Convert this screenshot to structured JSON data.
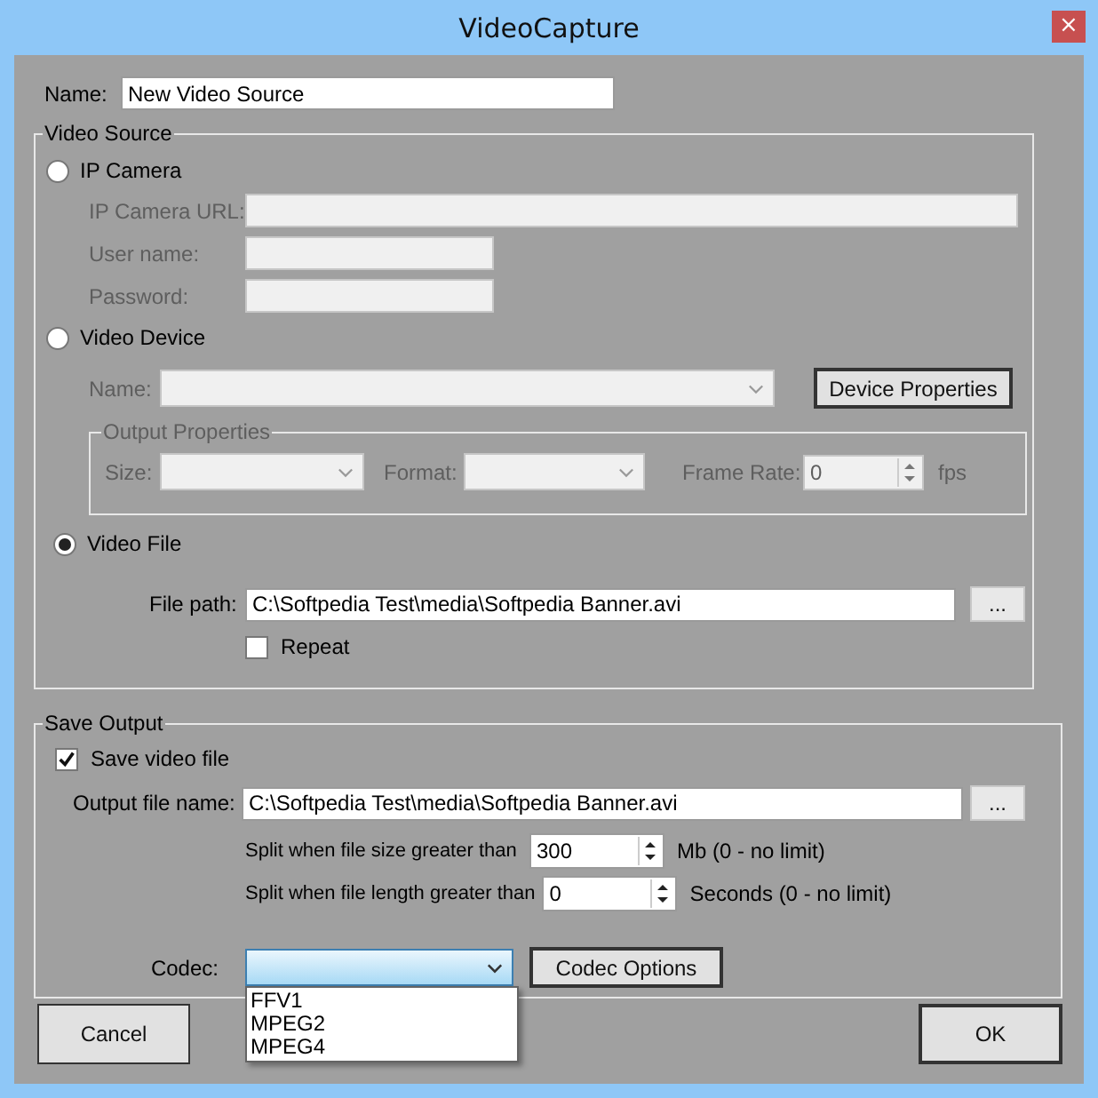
{
  "window": {
    "title": "VideoCapture",
    "close_glyph": "×"
  },
  "name_field": {
    "label": "Name:",
    "value": "New Video Source"
  },
  "video_source": {
    "title": "Video Source",
    "ip_camera": {
      "label": "IP Camera",
      "selected": false,
      "fields": [
        {
          "label": "IP Camera URL:",
          "disabled": true
        },
        {
          "label": "User name:",
          "disabled": true
        },
        {
          "label": "Password:",
          "disabled": true
        }
      ]
    },
    "video_device": {
      "label": "Video Device",
      "selected": false,
      "disabled": true,
      "name_label": "Name:",
      "device_properties_button": "Device Properties",
      "output_properties": {
        "title": "Output Properties",
        "size_label": "Size:",
        "format_label": "Format:",
        "frame_rate_label": "Frame Rate:",
        "frame_rate": "0",
        "fps_label": "fps"
      }
    },
    "video_file": {
      "label": "Video File",
      "selected": true,
      "file_path_label": "File path:",
      "file_path": "C:\\Softpedia Test\\media\\Softpedia Banner.avi",
      "browse_button": "...",
      "repeat": {
        "label": "Repeat",
        "checked": false
      }
    }
  },
  "save_output": {
    "title": "Save Output",
    "save_video_file": {
      "label": "Save video file",
      "checked": true
    },
    "output_file_label": "Output file name:",
    "output_file": "C:\\Softpedia Test\\media\\Softpedia Banner.avi",
    "browse_button": "...",
    "splits": [
      {
        "label": "Split when file size greater than",
        "value": "300",
        "unit": "Mb (0 - no limit)"
      },
      {
        "label": "Split when file length greater than",
        "value": "0",
        "unit": "Seconds (0 - no limit)"
      }
    ],
    "codec": {
      "label": "Codec:",
      "expanded": true,
      "options": [
        "FFV1",
        "MPEG2",
        "MPEG4"
      ],
      "options_button": "Codec Options"
    }
  },
  "buttons": [
    "Cancel",
    "OK"
  ]
}
